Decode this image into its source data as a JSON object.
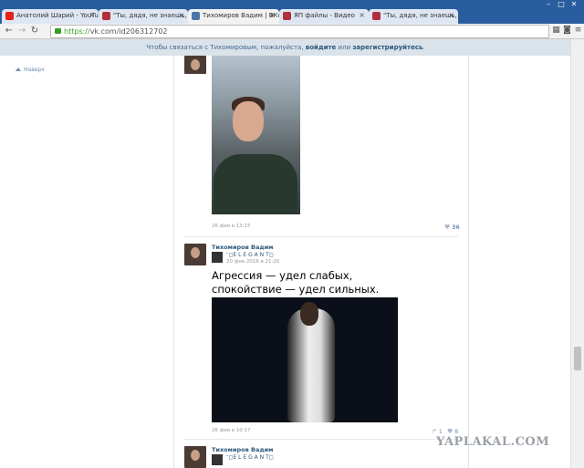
{
  "browser": {
    "tabs": [
      {
        "label": "Анатолий Шарий - YouTu",
        "fav_color": "#e62117"
      },
      {
        "label": "\"Ты, дядя, не знаешь, с к",
        "fav_color": "#b02f3c"
      },
      {
        "label": "Тихомиров Вадим | ВКон",
        "fav_color": "#4a76a8"
      },
      {
        "label": "ЯП файлы - Видео",
        "fav_color": "#b02f3c"
      },
      {
        "label": "\"Ты, дядя, не знаешь, с к",
        "fav_color": "#b02f3c"
      }
    ],
    "url_scheme": "https://",
    "url_domain": "vk.com",
    "url_path": "/id206312702"
  },
  "banner": {
    "prefix": "Чтобы связаться с Тихомировым, пожалуйста, ",
    "login": "войдите",
    "middle": " или ",
    "register": "зарегистрируйтесь",
    "suffix": "."
  },
  "leftnav": {
    "up_label": "Наверх"
  },
  "posts": [
    {
      "date": "26 фев в 13:15",
      "likes": "36"
    },
    {
      "author": "Тихомиров Вадим",
      "repost_from": "ᵔ◻E L E G A N T◻",
      "repost_date": "20 фев 2016 в 21:20",
      "text_line1": "Агрессия — удел слабых,",
      "text_line2": "спокойствие — удел сильных.",
      "date": "26 фев в 10:17",
      "shares": "1",
      "likes": "8"
    },
    {
      "author": "Тихомиров Вадим",
      "repost_from": "ᵔ◻E L E G A N T◻"
    }
  ],
  "watermark": "YAPLAKAL.COM"
}
